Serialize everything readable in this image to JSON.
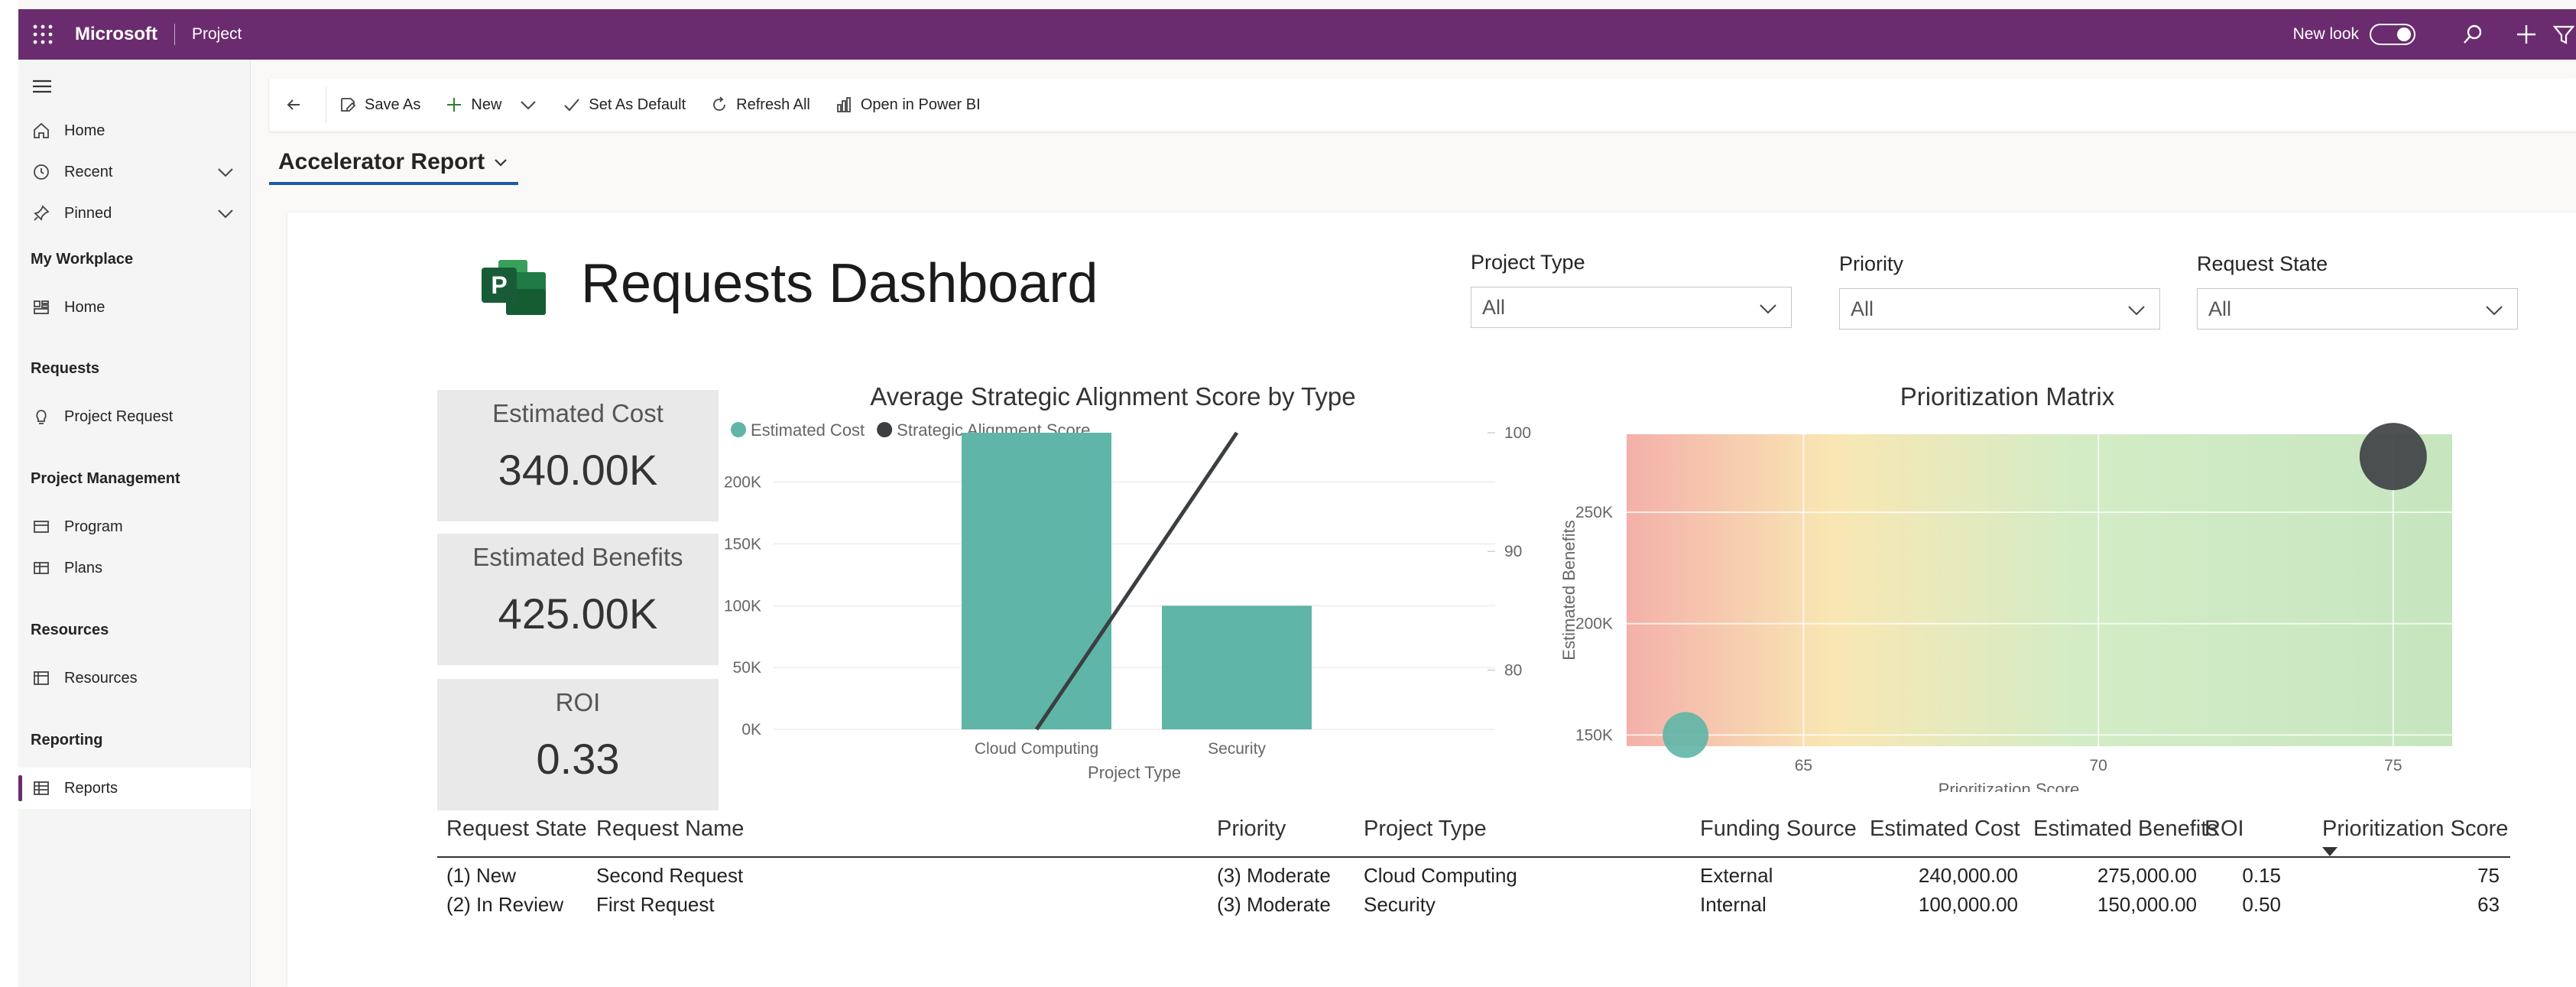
{
  "topbar": {
    "brand": "Microsoft",
    "app_name": "Project",
    "new_look_label": "New look"
  },
  "sidebar": {
    "items_top": [
      {
        "label": "Home",
        "icon": "home-icon"
      },
      {
        "label": "Recent",
        "icon": "clock-icon"
      },
      {
        "label": "Pinned",
        "icon": "pin-icon"
      }
    ],
    "sections": [
      {
        "title": "My Workplace",
        "items": [
          {
            "label": "Home",
            "icon": "home-icon"
          }
        ]
      },
      {
        "title": "Requests",
        "items": [
          {
            "label": "Project Request",
            "icon": "lightbulb-icon"
          }
        ]
      },
      {
        "title": "Project Management",
        "items": [
          {
            "label": "Program",
            "icon": "program-icon"
          },
          {
            "label": "Plans",
            "icon": "plans-icon"
          }
        ]
      },
      {
        "title": "Resources",
        "items": [
          {
            "label": "Resources",
            "icon": "resources-icon"
          }
        ]
      },
      {
        "title": "Reporting",
        "items": [
          {
            "label": "Reports",
            "icon": "reports-icon",
            "selected": true
          }
        ]
      }
    ]
  },
  "commandbar": {
    "save_as": "Save As",
    "new": "New",
    "set_as_default": "Set As Default",
    "refresh_all": "Refresh All",
    "open_in_power_bi": "Open in Power BI"
  },
  "report": {
    "name": "Accelerator Report"
  },
  "dashboard": {
    "title": "Requests Dashboard",
    "filters": [
      {
        "label": "Project Type",
        "value": "All"
      },
      {
        "label": "Priority",
        "value": "All"
      },
      {
        "label": "Request State",
        "value": "All"
      }
    ],
    "kpis": [
      {
        "label": "Estimated Cost",
        "value": "340.00K"
      },
      {
        "label": "Estimated Benefits",
        "value": "425.00K"
      },
      {
        "label": "ROI",
        "value": "0.33"
      }
    ]
  },
  "chart_data": [
    {
      "type": "bar",
      "title": "Average Strategic Alignment Score by Type",
      "categories": [
        "Cloud Computing",
        "Security"
      ],
      "series": [
        {
          "name": "Estimated Cost",
          "kind": "bar",
          "axis": "left",
          "values": [
            240000,
            100000
          ],
          "color": "#5fb5a7"
        },
        {
          "name": "Strategic Alignment Score",
          "kind": "line",
          "axis": "right",
          "values": [
            75,
            100
          ],
          "color": "#3b3f42"
        }
      ],
      "xlabel": "Project Type",
      "ylim_left": [
        0,
        240000
      ],
      "yticks_left": [
        "0K",
        "50K",
        "100K",
        "150K",
        "200K"
      ],
      "ylim_right": [
        75,
        100
      ],
      "yticks_right": [
        "80",
        "90",
        "100"
      ],
      "legend_position": "top-left",
      "grid": true
    },
    {
      "type": "scatter",
      "title": "Prioritization Matrix",
      "xlabel": "Prioritization Score",
      "ylabel": "Estimated Benefits",
      "xlim": [
        62,
        76
      ],
      "ylim": [
        145000,
        285000
      ],
      "xticks": [
        "65",
        "70",
        "75"
      ],
      "yticks": [
        "150K",
        "200K",
        "250K"
      ],
      "points": [
        {
          "x": 63,
          "y": 150000,
          "size": "small",
          "color": "#5fb5a7"
        },
        {
          "x": 75,
          "y": 275000,
          "size": "large",
          "color": "#3b3f42"
        }
      ],
      "background": "gradient red-yellow-green",
      "grid": true
    }
  ],
  "table": {
    "columns": [
      "Request State",
      "Request Name",
      "Priority",
      "Project Type",
      "Funding Source",
      "Estimated Cost",
      "Estimated Benefits",
      "ROI",
      "Prioritization Score"
    ],
    "rows": [
      [
        "(1) New",
        "Second Request",
        "(3) Moderate",
        "Cloud Computing",
        "External",
        "240,000.00",
        "275,000.00",
        "0.15",
        "75"
      ],
      [
        "(2) In Review",
        "First Request",
        "(3) Moderate",
        "Security",
        "Internal",
        "100,000.00",
        "150,000.00",
        "0.50",
        "63"
      ]
    ]
  }
}
